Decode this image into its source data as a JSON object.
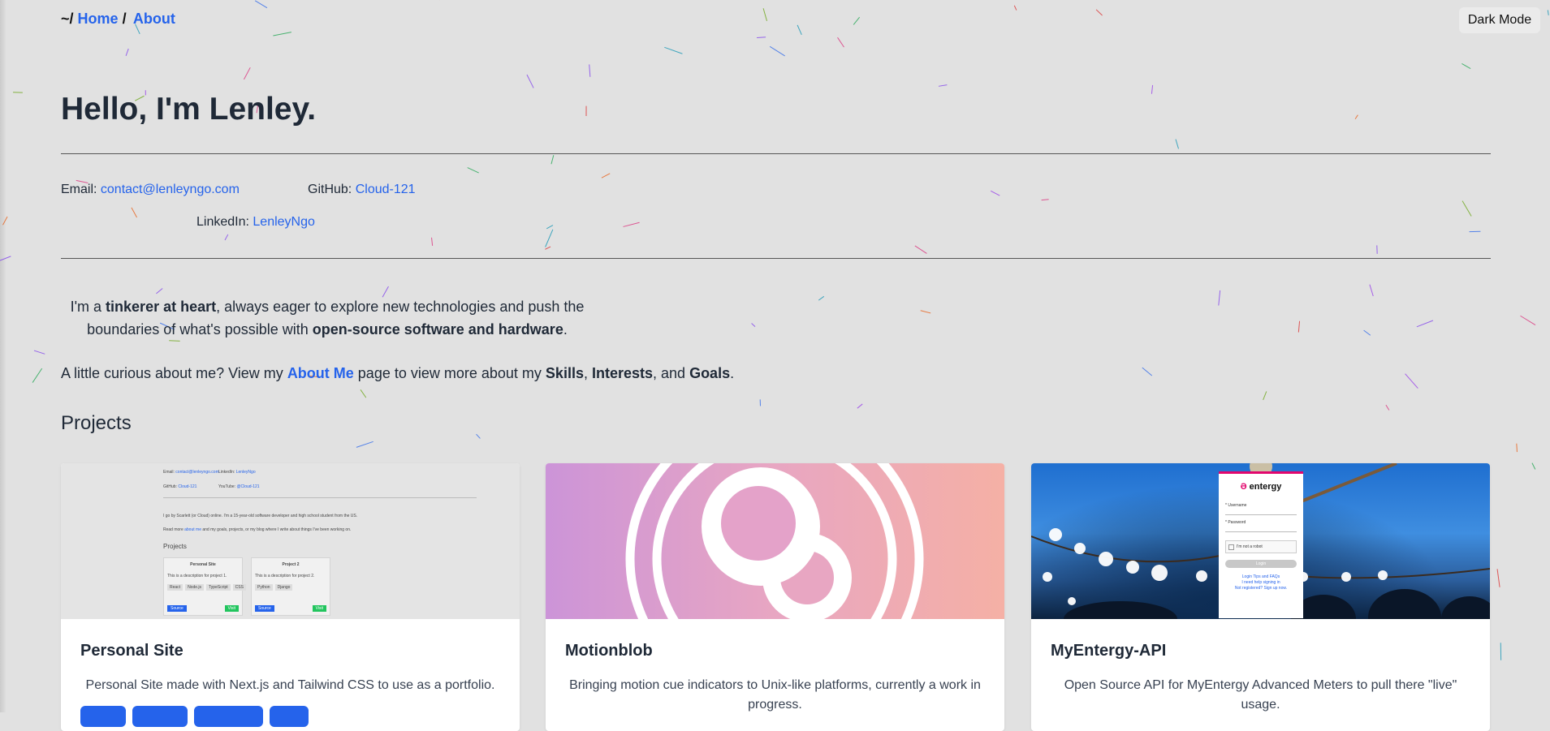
{
  "breadcrumb": {
    "root": "~/",
    "home": "Home",
    "separator": "/",
    "current": "About"
  },
  "theme_toggle": {
    "label": "Dark Mode"
  },
  "hero": {
    "title": "Hello, I'm Lenley."
  },
  "contacts": {
    "email": {
      "label": "Email:",
      "value": "contact@lenleyngo.com"
    },
    "github": {
      "label": "GitHub:",
      "value": "Cloud-121"
    },
    "linkedin": {
      "label": "LinkedIn:",
      "value": "LenleyNgo"
    }
  },
  "intro": {
    "part1": "I'm a ",
    "bold1": "tinkerer at heart",
    "part2": ", always eager to explore new technologies and push the boundaries of what's possible with ",
    "bold2": "open-source software and hardware",
    "part3": "."
  },
  "curious": {
    "part1": "A little curious about me? View my ",
    "link": "About Me",
    "part2": " page to view more about my ",
    "skills": "Skills",
    "comma": ", ",
    "interests": "Interests",
    "and": ", and ",
    "goals": "Goals",
    "end": "."
  },
  "projects": {
    "title": "Projects",
    "cards": [
      {
        "title": "Personal Site",
        "description": "Personal Site made with Next.js and Tailwind CSS to use as a portfolio.",
        "thumb": {
          "email_label": "Email:",
          "email": "contact@lenleyngo.com",
          "linkedin_label": "LinkedIn:",
          "linkedin": "LenleyNgo",
          "github_label": "GitHub:",
          "github": "Cloud-121",
          "youtube_label": "YouTube:",
          "youtube": "@Cloud-121",
          "intro": "I go by Scarlett (or Cloud) online. I'm a 15-year-old software developer and high school student from the US.",
          "more_prefix": "Read more",
          "more_link": "about me",
          "more_suffix": "and my goals, projects, or my blog where I write about things I've been working on.",
          "projects_title": "Projects",
          "p1_title": "Personal Site",
          "p1_desc": "This is a description for project 1.",
          "p1_tags": [
            "React",
            "Node.js",
            "TypeScript",
            "CSS"
          ],
          "p2_title": "Project 2",
          "p2_desc": "This is a description for project 2.",
          "p2_tags": [
            "Python",
            "Django"
          ],
          "source": "Source",
          "visit": "Visit"
        }
      },
      {
        "title": "Motionblob",
        "description": "Bringing motion cue indicators to Unix-like platforms, currently a work in progress."
      },
      {
        "title": "MyEntergy-API",
        "description": "Open Source API for MyEntergy Advanced Meters to pull there \"live\" usage.",
        "thumb": {
          "brand": "entergy",
          "field1": "* Username",
          "field2": "* Password",
          "captcha": "I'm not a robot",
          "login": "Login",
          "help1": "Login Tips and FAQs",
          "help2": "I need help signing in",
          "help3": "Not registered? Sign up now."
        }
      }
    ]
  },
  "colors": {
    "link": "#2563eb",
    "background": "#e1e1e1",
    "text": "#1f2937",
    "entergy_accent": "#e2066d"
  }
}
